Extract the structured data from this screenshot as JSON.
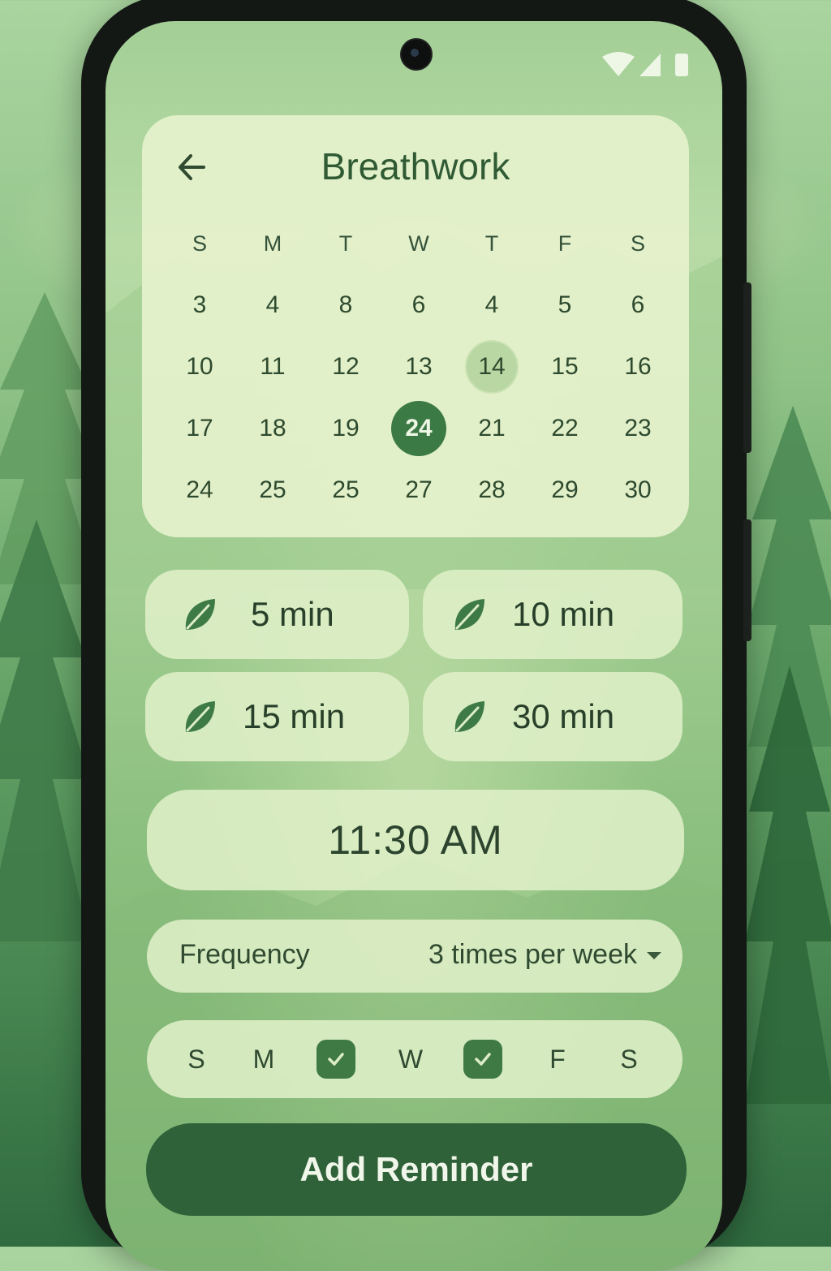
{
  "header": {
    "title": "Breathwork"
  },
  "calendar": {
    "weekday_headers": [
      "S",
      "M",
      "T",
      "W",
      "T",
      "F",
      "S"
    ],
    "rows": [
      [
        "3",
        "4",
        "8",
        "6",
        "4",
        "5",
        "6"
      ],
      [
        "10",
        "11",
        "12",
        "13",
        "14",
        "15",
        "16"
      ],
      [
        "17",
        "18",
        "19",
        "24",
        "21",
        "22",
        "23"
      ],
      [
        "24",
        "25",
        "25",
        "27",
        "28",
        "29",
        "30"
      ]
    ],
    "selected_day": "24",
    "highlighted_day": "14"
  },
  "durations": [
    {
      "label": "5 min",
      "icon": "leaf-icon"
    },
    {
      "label": "10 min",
      "icon": "leaf-icon"
    },
    {
      "label": "15 min",
      "icon": "leaf-icon"
    },
    {
      "label": "30 min",
      "icon": "leaf-icon"
    }
  ],
  "time": {
    "value": "11:30 AM"
  },
  "frequency": {
    "label": "Frequency",
    "value": "3 times per week"
  },
  "weekday_picker": {
    "days": [
      {
        "label": "S",
        "checked": false
      },
      {
        "label": "M",
        "checked": false
      },
      {
        "label": "",
        "checked": true
      },
      {
        "label": "W",
        "checked": false
      },
      {
        "label": "",
        "checked": true
      },
      {
        "label": "F",
        "checked": false
      },
      {
        "label": "S",
        "checked": false
      }
    ]
  },
  "actions": {
    "add_label": "Add Reminder"
  },
  "colors": {
    "accent": "#3c7a45",
    "button": "#2f6238",
    "card": "#e6f2cd",
    "text": "#2e4a2e"
  }
}
